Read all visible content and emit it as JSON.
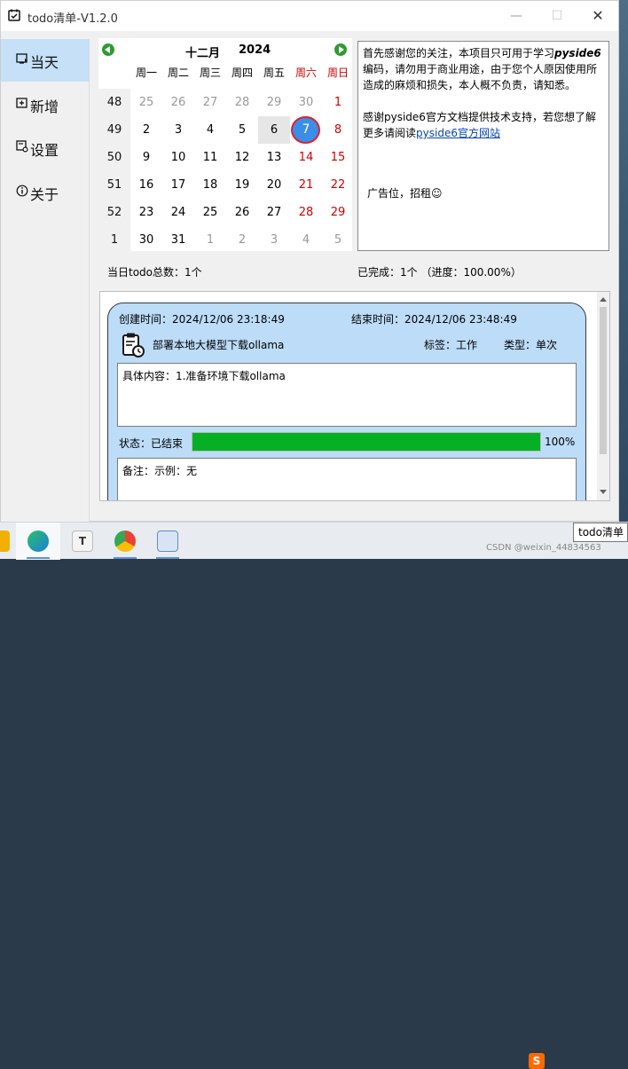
{
  "window": {
    "title": "todo清单-V1.2.0"
  },
  "sidebar": {
    "items": [
      {
        "label": "当天",
        "icon": "today-icon",
        "active": true
      },
      {
        "label": "新增",
        "icon": "add-icon",
        "active": false
      },
      {
        "label": "设置",
        "icon": "settings-icon",
        "active": false
      },
      {
        "label": "关于",
        "icon": "info-icon",
        "active": false
      }
    ]
  },
  "calendar": {
    "month": "十二月",
    "year": "2024",
    "weekdays": [
      "周一",
      "周二",
      "周三",
      "周四",
      "周五",
      "周六",
      "周日"
    ],
    "weeks": [
      {
        "num": "48",
        "days": [
          "25",
          "26",
          "27",
          "28",
          "29",
          "30",
          "1"
        ]
      },
      {
        "num": "49",
        "days": [
          "2",
          "3",
          "4",
          "5",
          "6",
          "7",
          "8"
        ]
      },
      {
        "num": "50",
        "days": [
          "9",
          "10",
          "11",
          "12",
          "13",
          "14",
          "15"
        ]
      },
      {
        "num": "51",
        "days": [
          "16",
          "17",
          "18",
          "19",
          "20",
          "21",
          "22"
        ]
      },
      {
        "num": "52",
        "days": [
          "23",
          "24",
          "25",
          "26",
          "27",
          "28",
          "29"
        ]
      },
      {
        "num": "1",
        "days": [
          "30",
          "31",
          "1",
          "2",
          "3",
          "4",
          "5"
        ]
      }
    ],
    "selected_day": "7"
  },
  "notice": {
    "line1": "首先感谢您的关注，本项目只可用于学习",
    "em": "pyside6",
    "line2": "编码，请勿用于商业用途，由于您个人原因使用所造成的麻烦和损失，本人概不负责，请知悉。",
    "line3": "感谢pyside6官方文档提供技术支持，若您想了解更多请阅读",
    "link": "pyside6官方网站",
    "ad": "广告位，招租☺"
  },
  "summary": {
    "total": "当日todo总数：1个",
    "done": "已完成：1个 （进度：100.00%）"
  },
  "task": {
    "created": "创建时间：2024/12/06 23:18:49",
    "ended": "结束时间：2024/12/06 23:48:49",
    "name": "部署本地大模型下载ollama",
    "tag": "标签：工作",
    "type": "类型：单次",
    "content": "具体内容：1.准备环境下载ollama",
    "status": "状态：已结束",
    "progress": 1.0,
    "progress_text": "100%",
    "remark": "备注：示例：无"
  },
  "taskbar": {
    "tooltip": "todo清单",
    "watermark": "CSDN @weixin_44834563"
  }
}
